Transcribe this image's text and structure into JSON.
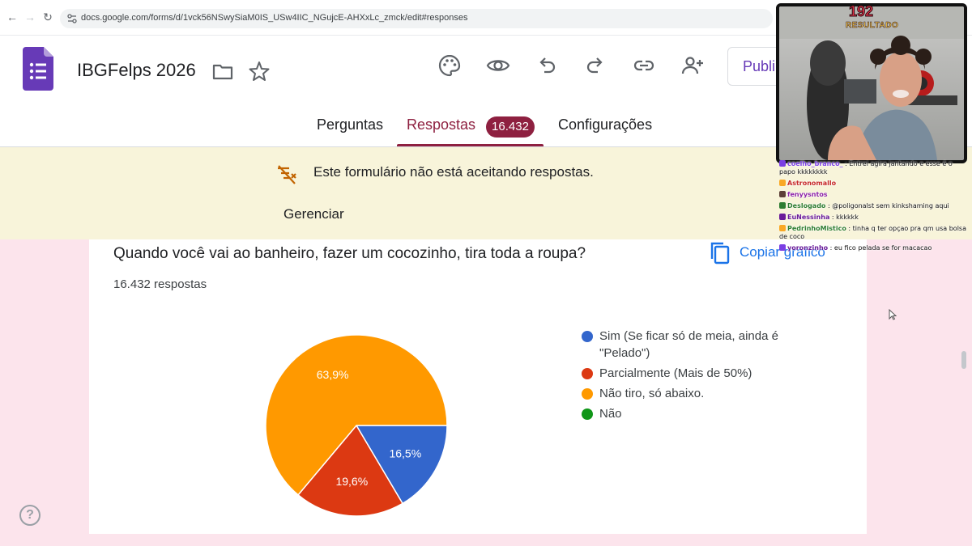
{
  "browser": {
    "url": "docs.google.com/forms/d/1vck56NSwySiaM0IS_USw4IIC_NGujcE-AHXxLc_zmck/edit#responses"
  },
  "form": {
    "title": "IBGFelps 2026",
    "publish_label": "Publi",
    "tabs": [
      {
        "label": "Perguntas"
      },
      {
        "label": "Respostas",
        "badge": "16.432"
      },
      {
        "label": "Configurações"
      }
    ],
    "active_tab": 1
  },
  "notice": {
    "text": "Este formulário não está aceitando respostas.",
    "action": "Gerenciar"
  },
  "question": {
    "title": "Quando você vai ao banheiro, fazer um cocozinho, tira toda a roupa?",
    "response_count": "16.432 respostas",
    "copy_label": "Copiar gráfico"
  },
  "chart_data": {
    "type": "pie",
    "slices": [
      {
        "label": "Sim (Se ficar só de meia, ainda é \"Pelado\")",
        "value": 16.5,
        "display": "16,5%",
        "color": "#3366cc"
      },
      {
        "label": "Parcialmente (Mais de 50%)",
        "value": 19.6,
        "display": "19,6%",
        "color": "#dc3912"
      },
      {
        "label": "Não tiro, só abaixo.",
        "value": 63.9,
        "display": "63,9%",
        "color": "#ff9900"
      },
      {
        "label": "Não",
        "value": 0,
        "display": "",
        "color": "#109618"
      }
    ],
    "legend": "right"
  },
  "stream": {
    "score": "192",
    "score_label": "RESULTADO",
    "chat": [
      {
        "user": "coelho_branco_",
        "text": "Entrei agira jantando e esse é o papo kkkkkkkk",
        "user_color": "#7b3fe4",
        "icon_color": "#7b3fe4"
      },
      {
        "user": "Astronomallo",
        "text": "",
        "user_color": "#c62828",
        "icon_color": "#f9a825"
      },
      {
        "user": "fenyysntos",
        "text": "",
        "user_color": "#8e24aa",
        "icon_color": "#5d4037"
      },
      {
        "user": "Deslogado",
        "text": "@poligonalst sem kinkshaming aqui",
        "user_color": "#2e7d32",
        "icon_color": "#2e7d32"
      },
      {
        "user": "EuNessinha",
        "text": "kkkkkk",
        "user_color": "#6a1b9a",
        "icon_color": "#6a1b9a"
      },
      {
        "user": "PedrinhoMistico",
        "text": "tinha q ter opçao pra qm usa bolsa de coco",
        "user_color": "#2e7d32",
        "icon_color": "#f9a825"
      },
      {
        "user": "yoronzinho",
        "text": "eu fico pelada se for macacao",
        "user_color": "#6a1b9a",
        "icon_color": "#7b3fe4"
      }
    ]
  }
}
